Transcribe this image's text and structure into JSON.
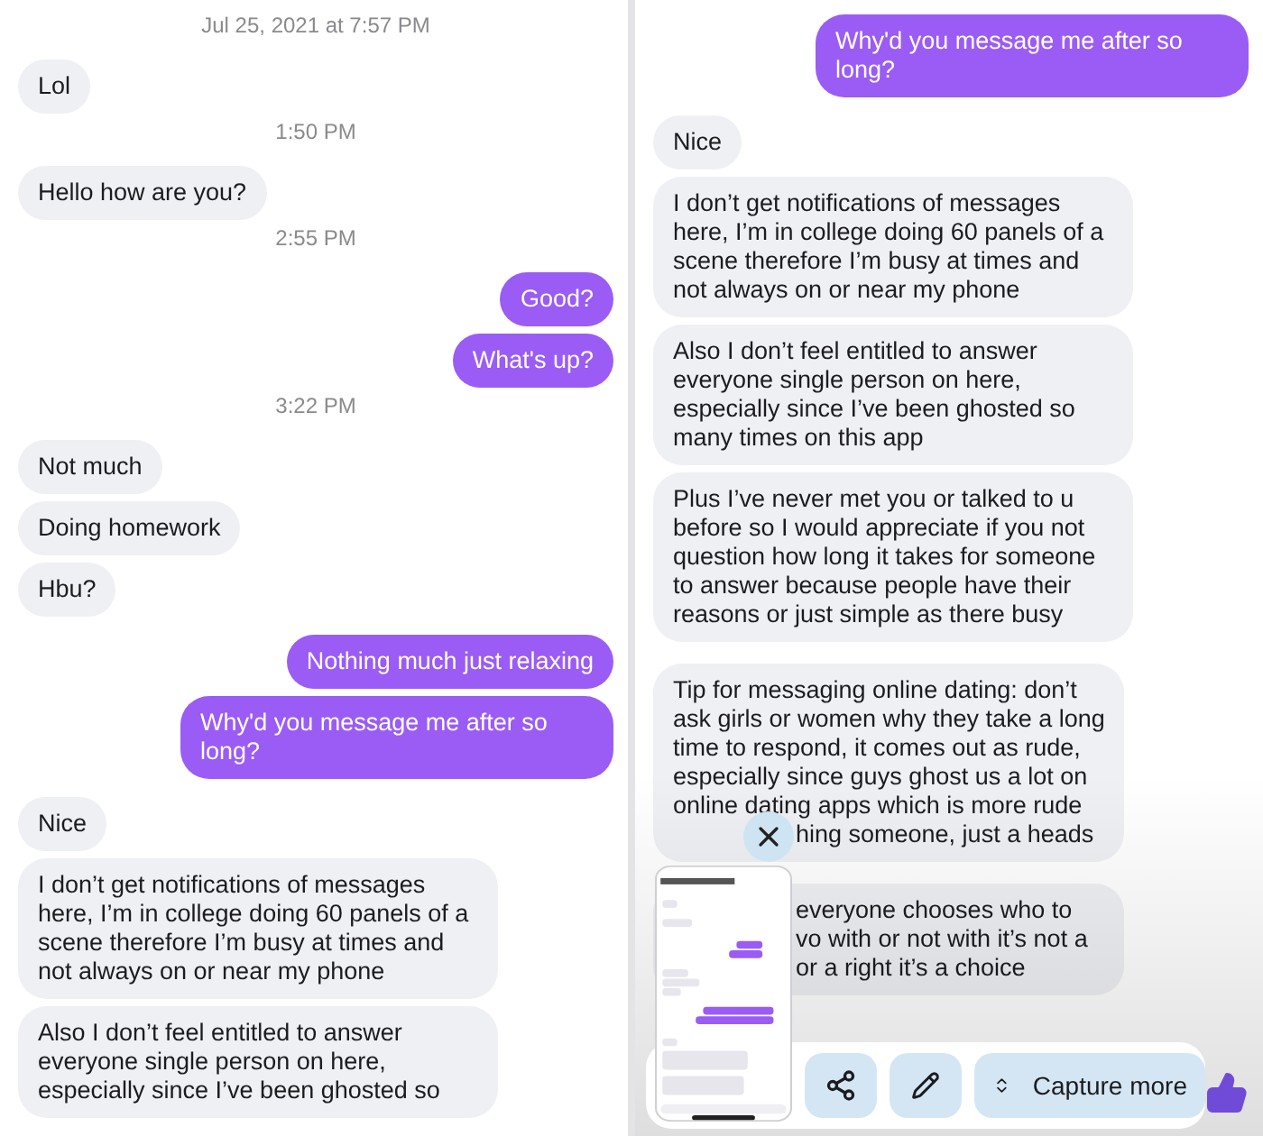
{
  "panels": [
    {
      "messages": [
        {
          "kind": "time",
          "text": "Jul 25, 2021 at 7:57 PM"
        },
        {
          "kind": "received",
          "text": "Lol"
        },
        {
          "kind": "time",
          "text": "1:50 PM"
        },
        {
          "kind": "received",
          "text": "Hello how are you?"
        },
        {
          "kind": "time",
          "text": "2:55 PM"
        },
        {
          "kind": "sent",
          "text": "Good?"
        },
        {
          "kind": "sent",
          "text": "What's up?"
        },
        {
          "kind": "time",
          "text": "3:22 PM"
        },
        {
          "kind": "received",
          "text": "Not much"
        },
        {
          "kind": "received",
          "text": "Doing homework"
        },
        {
          "kind": "received",
          "text": "Hbu?"
        },
        {
          "kind": "sent",
          "text": "Nothing much just relaxing"
        },
        {
          "kind": "sent",
          "text": "Why'd you message me after so long?"
        },
        {
          "kind": "received",
          "text": "Nice"
        },
        {
          "kind": "received",
          "text": "I don’t get notifications of messages here, I’m in college doing 60 panels of a scene therefore I’m busy at times and not always on or near my phone"
        },
        {
          "kind": "received",
          "text": "Also I don’t feel entitled to answer everyone single person on here, especially since I’ve been ghosted so"
        }
      ]
    },
    {
      "messages": [
        {
          "kind": "sent",
          "text": "Why'd you message me after so long?"
        },
        {
          "kind": "received",
          "text": "Nice"
        },
        {
          "kind": "received",
          "text": "I don’t get notifications of messages here, I’m in college doing 60 panels of a scene therefore I’m busy at times and not always on or near my phone"
        },
        {
          "kind": "received",
          "text": "Also I don’t feel entitled to answer everyone single person on here, especially since I’ve been ghosted so many times on this app"
        },
        {
          "kind": "received",
          "text": "Plus I’ve never met you or talked to u before so I would appreciate if you  not question how long it takes for someone to answer because people have their reasons or just simple as there busy"
        },
        {
          "kind": "partial",
          "text": "Tip for messaging online dating: don’t ask girls or women why they take a long time to respond, it comes out as rude, especially since guys ghost us a lot on online dating apps which is more rude",
          "covered_lines": [
            "hing someone, just a heads"
          ]
        },
        {
          "kind": "partial",
          "covered_lines": [
            "everyone chooses who to",
            "vo with or not with it’s not a",
            "or a right it’s a choice"
          ]
        }
      ]
    }
  ],
  "capture_toolbar": {
    "capture_more": "Capture more"
  }
}
